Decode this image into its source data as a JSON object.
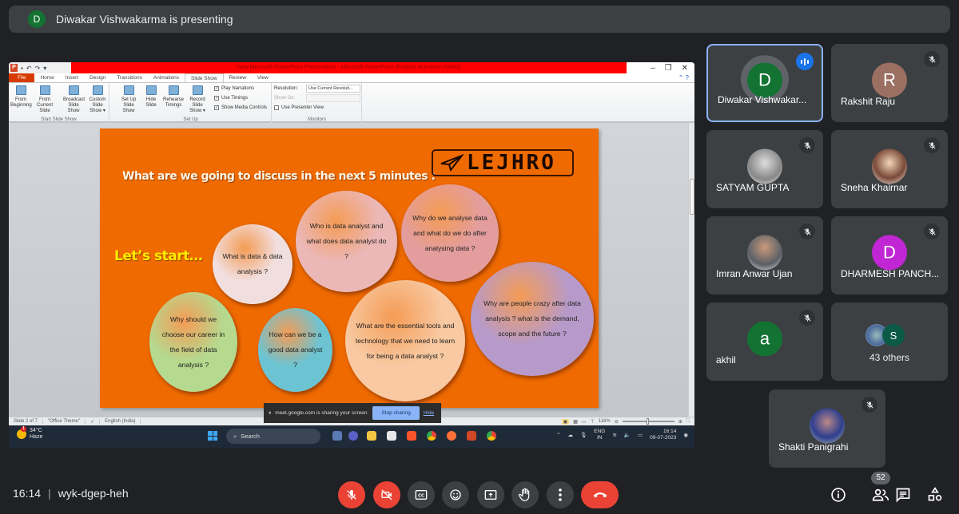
{
  "banner": {
    "presenter_initial": "D",
    "text": "Diwakar Vishwakarma is presenting"
  },
  "powerpoint": {
    "window_title": "New Microsoft PowerPoint Presentation - Microsoft PowerPoint (Product Activation Failed)",
    "tabs": [
      {
        "label": "File"
      },
      {
        "label": "Home"
      },
      {
        "label": "Insert"
      },
      {
        "label": "Design"
      },
      {
        "label": "Transitions"
      },
      {
        "label": "Animations"
      },
      {
        "label": "Slide Show",
        "active": true
      },
      {
        "label": "Review"
      },
      {
        "label": "View"
      }
    ],
    "ribbon": {
      "start_group": {
        "label": "Start Slide Show",
        "buttons": [
          {
            "l1": "From",
            "l2": "Beginning"
          },
          {
            "l1": "From",
            "l2": "Current Slide"
          },
          {
            "l1": "Broadcast",
            "l2": "Slide Show"
          },
          {
            "l1": "Custom",
            "l2": "Slide Show ▾"
          }
        ]
      },
      "setup_group": {
        "label": "Set Up",
        "buttons": [
          {
            "l1": "Set Up",
            "l2": "Slide Show"
          },
          {
            "l1": "Hide",
            "l2": "Slide"
          },
          {
            "l1": "Rehearse",
            "l2": "Timings"
          },
          {
            "l1": "Record",
            "l2": "Slide Show ▾"
          }
        ],
        "checkboxes": [
          {
            "label": "Play Narrations",
            "checked": true
          },
          {
            "label": "Use Timings",
            "checked": true
          },
          {
            "label": "Show Media Controls",
            "checked": true
          }
        ]
      },
      "monitors_group": {
        "label": "Monitors",
        "resolution_label": "Resolution:",
        "resolution_value": "Use Current Resoluti...",
        "show_on_label": "Show On:",
        "presenter_view_label": "Use Presenter View"
      }
    },
    "slide": {
      "heading": "What are we going to discuss in the next 5 minutes :",
      "logo_text": "LEJHRO",
      "lets_start": "Let’s start…",
      "bubbles": [
        {
          "text": "What is data & data analysis ?",
          "color": "#f1dfe0"
        },
        {
          "text": "Who is data analyst and what does data analyst do ?",
          "color": "#ebb7b7"
        },
        {
          "text": "Why do we analyse data and what do we do after analysing data ?",
          "color": "#e39d9d"
        },
        {
          "text": "Why should we choose our career in the field of data analysis ?",
          "color": "#b5d98f"
        },
        {
          "text": "How can we be a good data analyst ?",
          "color": "#6cc3d2"
        },
        {
          "text": "What are the essential tools and technology that we need to learn for being a data analyst ?",
          "color": "#f8c9a2"
        },
        {
          "text": "Why are people crazy after data analysis ? what is the demand, scope and the future ?",
          "color": "#b79ac9"
        }
      ]
    },
    "status": {
      "slide": "Slide 2 of 7",
      "theme": "\"Office Theme\"",
      "language": "English (India)",
      "zoom": "116%"
    }
  },
  "share_bar": {
    "message": "meet.google.com is sharing your screen.",
    "stop_label": "Stop sharing",
    "hide_label": "Hide"
  },
  "taskbar": {
    "temperature": "34°C",
    "condition": "Haze",
    "weather_badge": "1",
    "search_label": "Search",
    "lang1": "ENG",
    "lang2": "IN",
    "time": "16:14",
    "date": "09-07-2023"
  },
  "participants": [
    {
      "name": "Diwakar Vishwakar...",
      "initial": "D",
      "color": "#137333",
      "speaking": true
    },
    {
      "name": "Rakshit Raju",
      "initial": "R",
      "color": "#9c6f63",
      "muted": true
    },
    {
      "name": "SATYAM GUPTA",
      "photo": true,
      "muted": true
    },
    {
      "name": "Sneha Khairnar",
      "photo": true,
      "muted": true
    },
    {
      "name": "Imran Anwar Ujan",
      "photo": true,
      "muted": true
    },
    {
      "name": "DHARMESH PANCH...",
      "initial": "D",
      "color": "#c026d3",
      "muted": true
    },
    {
      "name": "akhil",
      "initial": "a",
      "color": "#137333",
      "muted": true
    },
    {
      "name": "43 others",
      "initial": "S",
      "color": "#0b5a47"
    },
    {
      "name": "Shakti Panigrahi",
      "photo": true,
      "muted": true
    }
  ],
  "meeting": {
    "time": "16:14",
    "separator": "|",
    "code": "wyk-dgep-heh",
    "participant_count": "52"
  },
  "colors": {
    "danger": "#ea4335",
    "accent": "#8ab4f8",
    "slide_bg": "#ef6a00"
  }
}
